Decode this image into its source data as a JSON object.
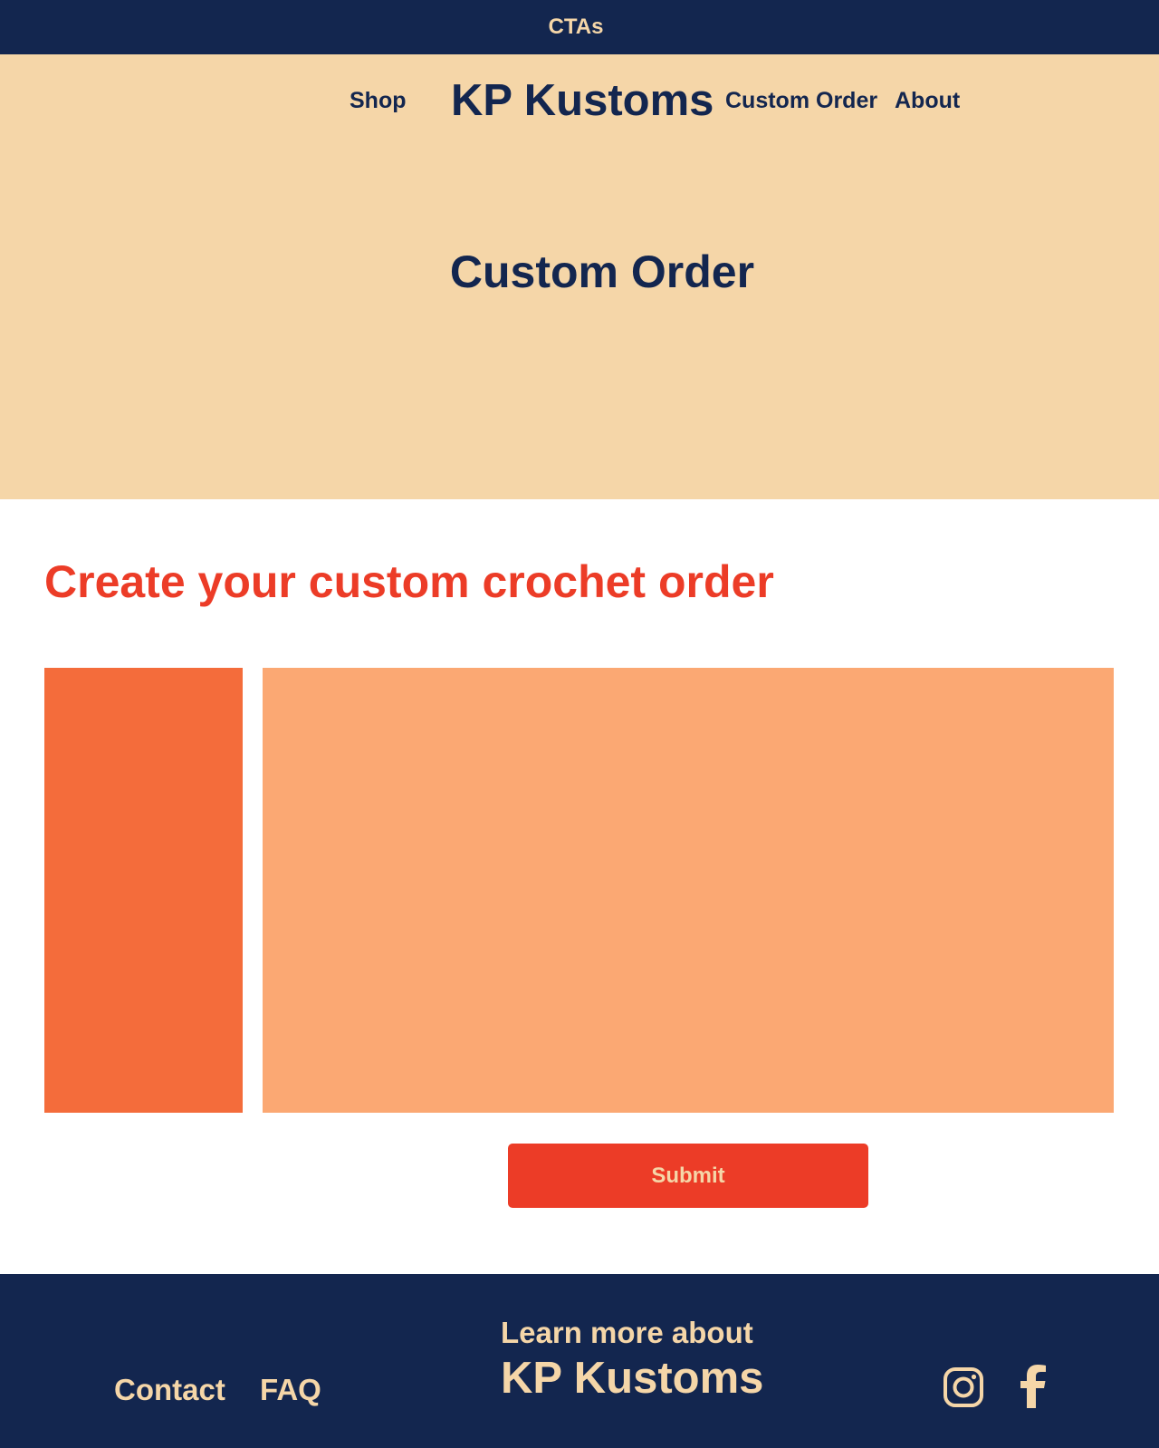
{
  "cta_bar": {
    "text": "CTAs"
  },
  "header": {
    "nav_left": "Shop",
    "brand": "KP Kustoms",
    "nav_right": [
      "Custom Order",
      "About"
    ]
  },
  "hero": {
    "title": "Custom Order"
  },
  "main": {
    "heading": "Create your custom crochet order",
    "submit_label": "Submit"
  },
  "footer": {
    "links": [
      "Contact",
      "FAQ"
    ],
    "tagline": "Learn more about",
    "brand": "KP Kustoms",
    "social_icons": [
      "instagram-icon",
      "facebook-icon"
    ]
  },
  "colors": {
    "navy": "#13264f",
    "cream": "#f5d6a8",
    "red": "#ec3c27",
    "orange": "#f46c3b",
    "peach": "#fba873"
  }
}
